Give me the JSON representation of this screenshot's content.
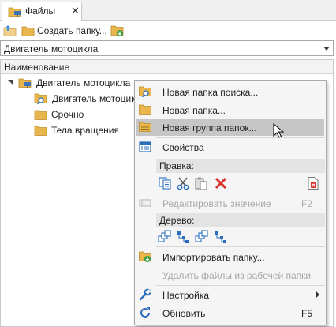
{
  "tab": {
    "label": "Файлы",
    "close": "✕"
  },
  "toolbar": {
    "create_folder_label": "Создать папку..."
  },
  "combo": {
    "value": "Двигатель мотоцикла"
  },
  "tree": {
    "column_header": "Наименование",
    "nodes": [
      {
        "label": "Двигатель мотоцикла"
      },
      {
        "label": "Двигатель мотоцик"
      },
      {
        "label": "Срочно"
      },
      {
        "label": "Тела вращения"
      }
    ]
  },
  "menu": {
    "new_search_folder": "Новая папка поиска...",
    "new_folder": "Новая папка...",
    "new_folder_group": "Новая группа папок...",
    "properties": "Свойства",
    "edit_group": "Правка:",
    "edit_value": "Редактировать значение",
    "edit_value_shortcut": "F2",
    "tree_group": "Дерево:",
    "import_folder": "Импортировать папку...",
    "delete_files": "Удалить файлы из рабочей папки",
    "settings": "Настройка",
    "refresh": "Обновить",
    "refresh_shortcut": "F5"
  },
  "colors": {
    "folder": "#e8b64c",
    "highlight": "#c6c6c6",
    "delete_red": "#d9342b",
    "accent_blue": "#2a6ebb",
    "green": "#2e9a3c"
  }
}
